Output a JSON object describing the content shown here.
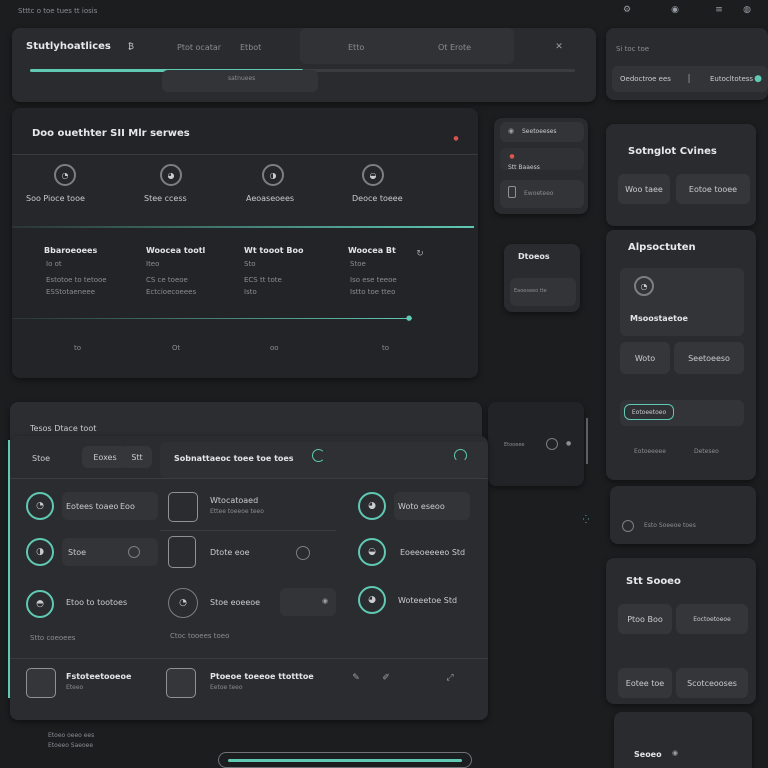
{
  "topbar": {
    "title": "Stttc o toe tues tt iosis"
  },
  "header_panel": {
    "title": "Stutlyhoatlices",
    "badge": "₿",
    "tab1": "Ptot ocatar",
    "tab2": "Etbot",
    "tab3": "Etto",
    "tab4": "Ot Erote",
    "progress": 0.5,
    "progress_label": "satnuees"
  },
  "right_header": {
    "title": "Si toc toe",
    "item": "Oedoctroe ees",
    "item2": "Eutocltotess"
  },
  "overview": {
    "title": "Doo ouethter SII Mlr serwes",
    "metrics": [
      {
        "label": "Soo Pioce tooe"
      },
      {
        "label": "Stee ccess"
      },
      {
        "label": "Aeoaseoees"
      },
      {
        "label": "Deoce toeee"
      }
    ],
    "columns": [
      {
        "head": "Bbaroeoees",
        "l1": "Io ot",
        "l2": "Estotoe to tetooe",
        "l3": "ESStotaeneee"
      },
      {
        "head": "Woocea tootl",
        "l1": "Iteo",
        "l2": "CS ce toeoe",
        "l3": "Ectcioecoeees"
      },
      {
        "head": "Wt tooot Boo",
        "l1": "Sto",
        "l2": "ECS tt tote",
        "l3": "Isto"
      },
      {
        "head": "Woocea Bt",
        "l1": "Stoe",
        "l2": "Iso ese teeoe",
        "l3": "Istto toe tteo"
      }
    ],
    "footer": [
      "to",
      "Ot",
      "oo",
      "to"
    ]
  },
  "mini_panel": {
    "r1": "Seetoeeses",
    "r2": "Stt Baaess",
    "r3": "Ewoeteeo"
  },
  "status_panel": {
    "title": "Dtoeos",
    "value": "Eaoeseeo tte"
  },
  "side_cards": {
    "card1": {
      "title": "Sotnglot Cvines",
      "b1": "Woo taee",
      "b2": "Eotoe tooee"
    },
    "card2": {
      "title": "Alpsoctuten",
      "sub": "Msoostaetoe",
      "b1": "Woto",
      "b2": "Seetoeeso",
      "slide": "Eotoeetoeo",
      "l1": "Eotoeeeee",
      "l2": "Deteseo"
    },
    "card3": {
      "label": "Esto Soeeoe toes"
    },
    "card4": {
      "title": "Stt Sooeo",
      "b1": "Ptoo Boo",
      "b2": "Eoctoetoeoe",
      "b3": "Eotee toe",
      "b4": "Scotceooses"
    },
    "card5": {
      "title": "Seoeo"
    }
  },
  "bottom_panel": {
    "top_label": "Tesos Dtace toot",
    "tab_label": "Stoe",
    "tab_chip": "Eoxes",
    "tab_badge": "Stt",
    "title": "Sobnattaeoc toee toe toes",
    "rows": [
      {
        "a": "Eotees toaeo",
        "a_val": "Eoo",
        "b": "Wtocatoaed",
        "b_sub": "Ettee toeeoe teeo",
        "c": "Woto eseoo"
      },
      {
        "a": "Stoe",
        "b": "Dtote eoe",
        "c": "Eoeeoeeeeo Std"
      },
      {
        "a": "Etoo to tootoes",
        "b": "Stoe eoeeoe",
        "c": "Woteeetoe  Std"
      }
    ],
    "row_note": "Stto coeoees",
    "row_note2": "Ctoc tooees toeo",
    "footer_a": "Fstoteetooeoe",
    "footer_a2": "Eteeo",
    "footer_b": "Ptoeoe toeeoe ttotttoe",
    "footer_b2": "Eetoe teeo",
    "below": "Etoeo oeeo ees",
    "below2": "Etoeeo Saeoee"
  },
  "mid_controls": {
    "label": "Etooeee",
    "dot": "●"
  }
}
